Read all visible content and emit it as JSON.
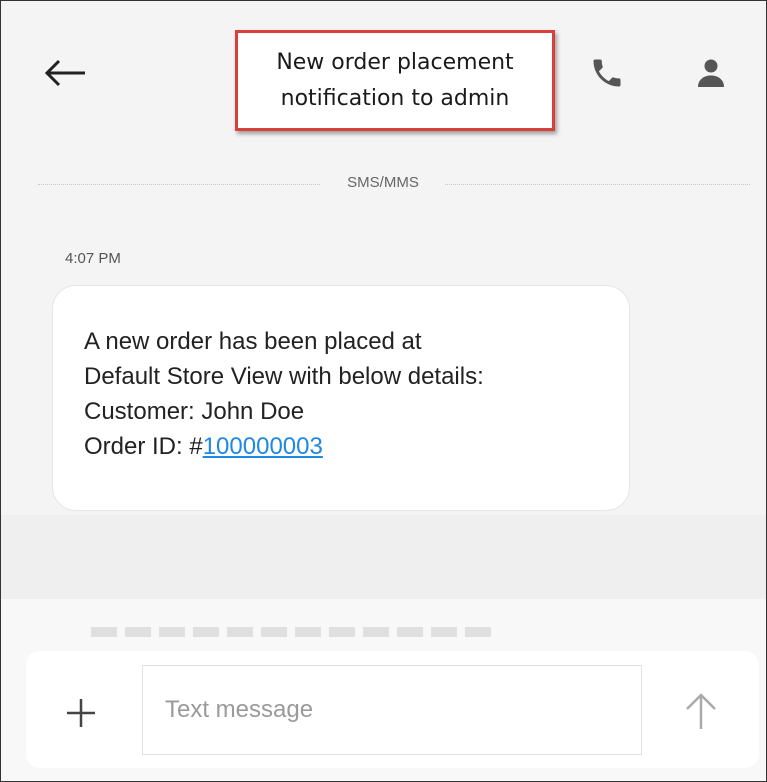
{
  "header": {
    "callout_text": "New order placement\nnotification to admin"
  },
  "thread": {
    "divider_label": "SMS/MMS",
    "timestamp": "4:07 PM",
    "message": {
      "line1": "A new order has been placed at",
      "line2": "Default Store View with below details:",
      "line3": "Customer: John Doe",
      "line4_prefix": "Order ID: #",
      "order_id": "100000003"
    }
  },
  "composer": {
    "placeholder": "Text message"
  },
  "icons": {
    "back": "arrow-left-icon",
    "call": "phone-icon",
    "contact": "person-icon",
    "add": "plus-icon",
    "send": "arrow-up-icon"
  },
  "colors": {
    "callout_border": "#d9403b",
    "link": "#1e88e5",
    "background": "#f4f4f4"
  }
}
